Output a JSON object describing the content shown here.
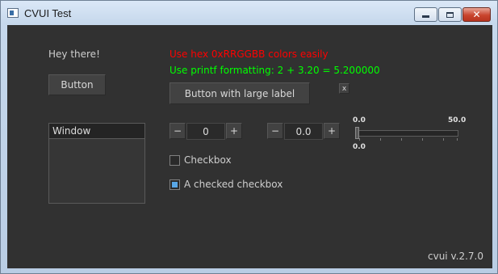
{
  "window": {
    "title": "CVUI Test",
    "controls": {
      "minimize": "minimize-icon",
      "maximize": "maximize-icon",
      "close": "close-icon"
    }
  },
  "canvas": {
    "greeting": "Hey there!",
    "button": "Button",
    "red_text": "Use hex 0xRRGGBB colors easily",
    "green_text": "Use printf formatting: 2 + 3.20 = 5.200000",
    "large_button": "Button with large label",
    "x_button": "x",
    "window_title": "Window",
    "counter_int": {
      "minus": "−",
      "value": "0",
      "plus": "+"
    },
    "counter_float": {
      "minus": "−",
      "value": "0.0",
      "plus": "+"
    },
    "trackbar": {
      "min_label": "0.0",
      "max_label": "50.0",
      "value_label": "0.0",
      "min": 0.0,
      "max": 50.0,
      "value": 0.0
    },
    "checkbox1": {
      "label": "Checkbox",
      "checked": false
    },
    "checkbox2": {
      "label": "A checked checkbox",
      "checked": true
    },
    "version": "cvui v.2.7.0"
  },
  "colors": {
    "background": "#313131",
    "red_text": "#ff0000",
    "green_text": "#00ff00",
    "checkbox_fill": "#59a7e6"
  }
}
